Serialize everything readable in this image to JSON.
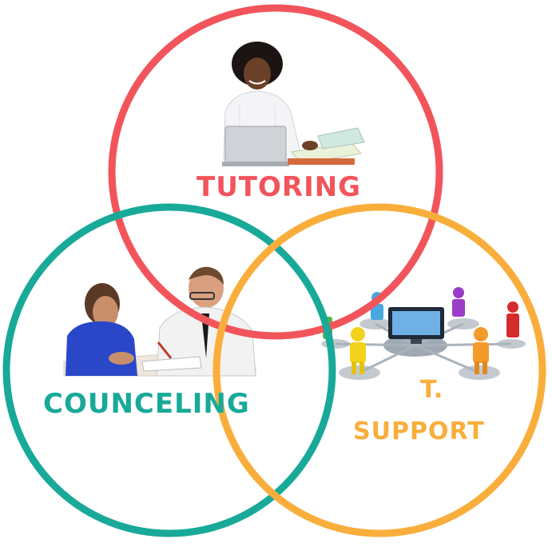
{
  "circles": [
    {
      "id": "tutoring",
      "label": "TUTORING",
      "color": "#f2545b",
      "image": "person-at-laptop-photo"
    },
    {
      "id": "counceling",
      "label": "COUNCELING",
      "color": "#18a999",
      "image": "counselor-with-student-photo"
    },
    {
      "id": "support",
      "label_line1": "T.",
      "label_line2": "SUPPORT",
      "color": "#f9ae3c",
      "image": "network-people-around-screen-illustration"
    }
  ]
}
